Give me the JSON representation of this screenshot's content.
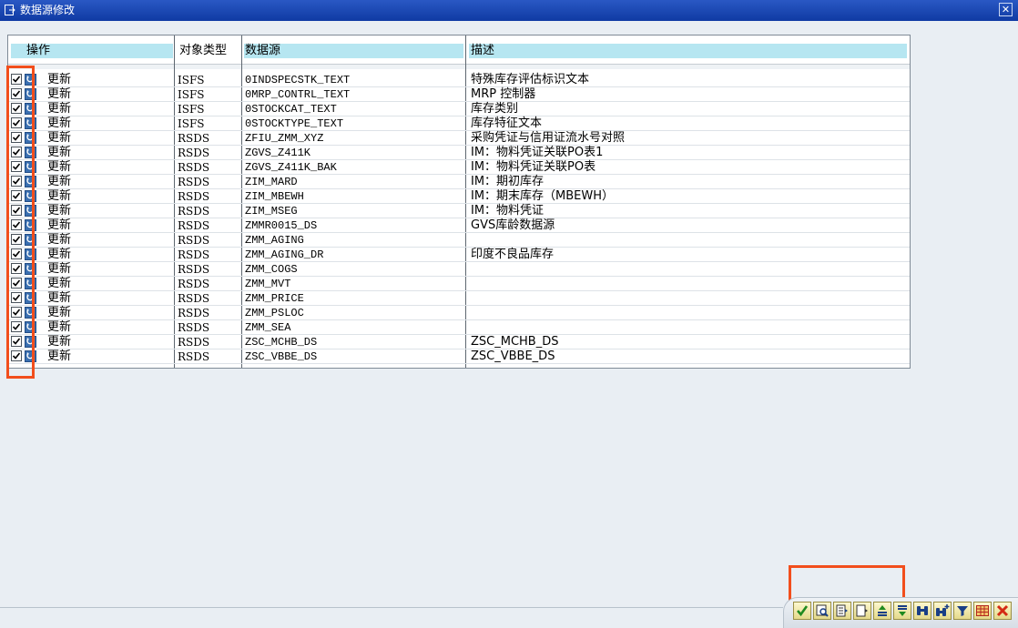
{
  "window": {
    "title": "数据源修改",
    "icon": "edit-document-icon",
    "close_icon": "close-icon"
  },
  "table": {
    "headers": {
      "action": "操作",
      "object_type": "对象类型",
      "datasource": "数据源",
      "description": "描述"
    },
    "rows": [
      {
        "checked": true,
        "action": "更新",
        "type": "ISFS",
        "source": "0INDSPECSTK_TEXT",
        "desc": "特殊库存评估标识文本"
      },
      {
        "checked": true,
        "action": "更新",
        "type": "ISFS",
        "source": "0MRP_CONTRL_TEXT",
        "desc": "MRP 控制器"
      },
      {
        "checked": true,
        "action": "更新",
        "type": "ISFS",
        "source": "0STOCKCAT_TEXT",
        "desc": "库存类别"
      },
      {
        "checked": true,
        "action": "更新",
        "type": "ISFS",
        "source": "0STOCKTYPE_TEXT",
        "desc": "库存特征文本"
      },
      {
        "checked": true,
        "action": "更新",
        "type": "RSDS",
        "source": "ZFIU_ZMM_XYZ",
        "desc": "采购凭证与信用证流水号对照"
      },
      {
        "checked": true,
        "action": "更新",
        "type": "RSDS",
        "source": "ZGVS_Z411K",
        "desc": "IM：物料凭证关联PO表1"
      },
      {
        "checked": true,
        "action": "更新",
        "type": "RSDS",
        "source": "ZGVS_Z411K_BAK",
        "desc": "IM：物料凭证关联PO表"
      },
      {
        "checked": true,
        "action": "更新",
        "type": "RSDS",
        "source": "ZIM_MARD",
        "desc": "IM：期初库存"
      },
      {
        "checked": true,
        "action": "更新",
        "type": "RSDS",
        "source": "ZIM_MBEWH",
        "desc": "IM：期末库存（MBEWH）"
      },
      {
        "checked": true,
        "action": "更新",
        "type": "RSDS",
        "source": "ZIM_MSEG",
        "desc": "IM：物料凭证"
      },
      {
        "checked": true,
        "action": "更新",
        "type": "RSDS",
        "source": "ZMMR0015_DS",
        "desc": "GVS库龄数据源"
      },
      {
        "checked": true,
        "action": "更新",
        "type": "RSDS",
        "source": "ZMM_AGING",
        "desc": ""
      },
      {
        "checked": true,
        "action": "更新",
        "type": "RSDS",
        "source": "ZMM_AGING_DR",
        "desc": "印度不良品库存"
      },
      {
        "checked": true,
        "action": "更新",
        "type": "RSDS",
        "source": "ZMM_COGS",
        "desc": ""
      },
      {
        "checked": true,
        "action": "更新",
        "type": "RSDS",
        "source": "ZMM_MVT",
        "desc": ""
      },
      {
        "checked": true,
        "action": "更新",
        "type": "RSDS",
        "source": "ZMM_PRICE",
        "desc": ""
      },
      {
        "checked": true,
        "action": "更新",
        "type": "RSDS",
        "source": "ZMM_PSLOC",
        "desc": ""
      },
      {
        "checked": true,
        "action": "更新",
        "type": "RSDS",
        "source": "ZMM_SEA",
        "desc": ""
      },
      {
        "checked": true,
        "action": "更新",
        "type": "RSDS",
        "source": "ZSC_MCHB_DS",
        "desc": "ZSC_MCHB_DS"
      },
      {
        "checked": true,
        "action": "更新",
        "type": "RSDS",
        "source": "ZSC_VBBE_DS",
        "desc": "ZSC_VBBE_DS"
      }
    ]
  },
  "toolbar": {
    "buttons": [
      {
        "name": "confirm-button",
        "icon": "checkmark-icon"
      },
      {
        "name": "details-button",
        "icon": "magnifier-icon"
      },
      {
        "name": "select-all-button",
        "icon": "select-all-icon"
      },
      {
        "name": "deselect-all-button",
        "icon": "deselect-all-icon"
      },
      {
        "name": "sort-ascending-button",
        "icon": "sort-ascending-icon"
      },
      {
        "name": "sort-descending-button",
        "icon": "sort-descending-icon"
      },
      {
        "name": "find-button",
        "icon": "binoculars-icon"
      },
      {
        "name": "find-next-button",
        "icon": "binoculars-plus-icon"
      },
      {
        "name": "filter-button",
        "icon": "filter-icon"
      },
      {
        "name": "layout-button",
        "icon": "grid-layout-icon"
      },
      {
        "name": "cancel-button",
        "icon": "cancel-icon"
      }
    ]
  },
  "colors": {
    "title_bar": "#1a47b4",
    "header_cell": "#b6e6f1",
    "highlight": "#f24e1c",
    "background": "#e9eef3"
  }
}
